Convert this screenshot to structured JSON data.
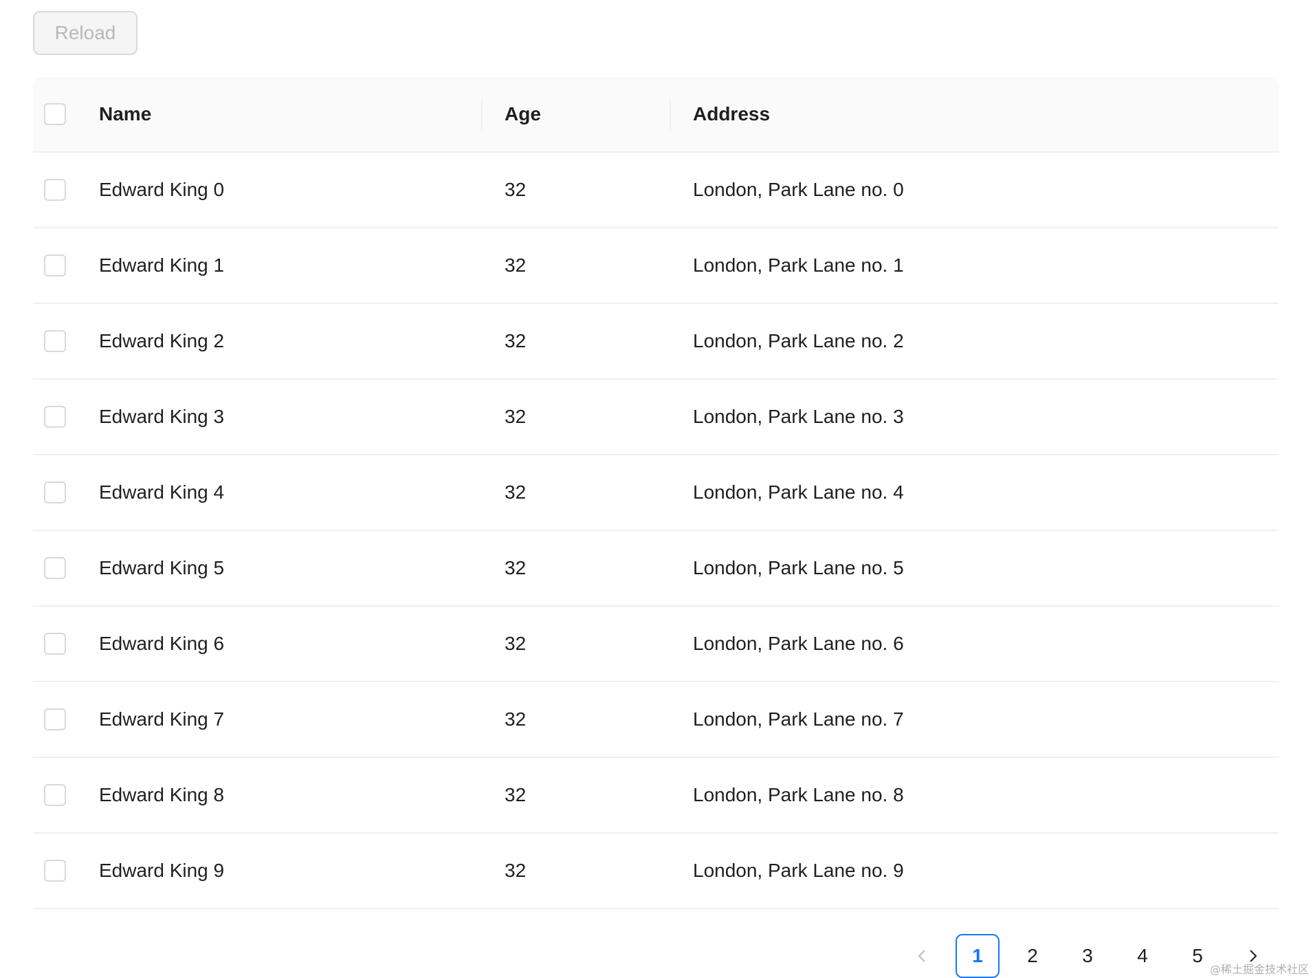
{
  "toolbar": {
    "reload_label": "Reload"
  },
  "table": {
    "columns": [
      "Name",
      "Age",
      "Address"
    ],
    "rows": [
      {
        "name": "Edward King 0",
        "age": "32",
        "address": "London, Park Lane no. 0"
      },
      {
        "name": "Edward King 1",
        "age": "32",
        "address": "London, Park Lane no. 1"
      },
      {
        "name": "Edward King 2",
        "age": "32",
        "address": "London, Park Lane no. 2"
      },
      {
        "name": "Edward King 3",
        "age": "32",
        "address": "London, Park Lane no. 3"
      },
      {
        "name": "Edward King 4",
        "age": "32",
        "address": "London, Park Lane no. 4"
      },
      {
        "name": "Edward King 5",
        "age": "32",
        "address": "London, Park Lane no. 5"
      },
      {
        "name": "Edward King 6",
        "age": "32",
        "address": "London, Park Lane no. 6"
      },
      {
        "name": "Edward King 7",
        "age": "32",
        "address": "London, Park Lane no. 7"
      },
      {
        "name": "Edward King 8",
        "age": "32",
        "address": "London, Park Lane no. 8"
      },
      {
        "name": "Edward King 9",
        "age": "32",
        "address": "London, Park Lane no. 9"
      }
    ]
  },
  "pagination": {
    "pages": [
      "1",
      "2",
      "3",
      "4",
      "5"
    ],
    "current": "1",
    "prev_icon": "chevron-left-icon",
    "next_icon": "chevron-right-icon"
  },
  "colors": {
    "accent": "#1677ff",
    "border": "#f0f0f0",
    "header_bg": "#fafafa"
  },
  "watermark": "@稀土掘金技术社区"
}
